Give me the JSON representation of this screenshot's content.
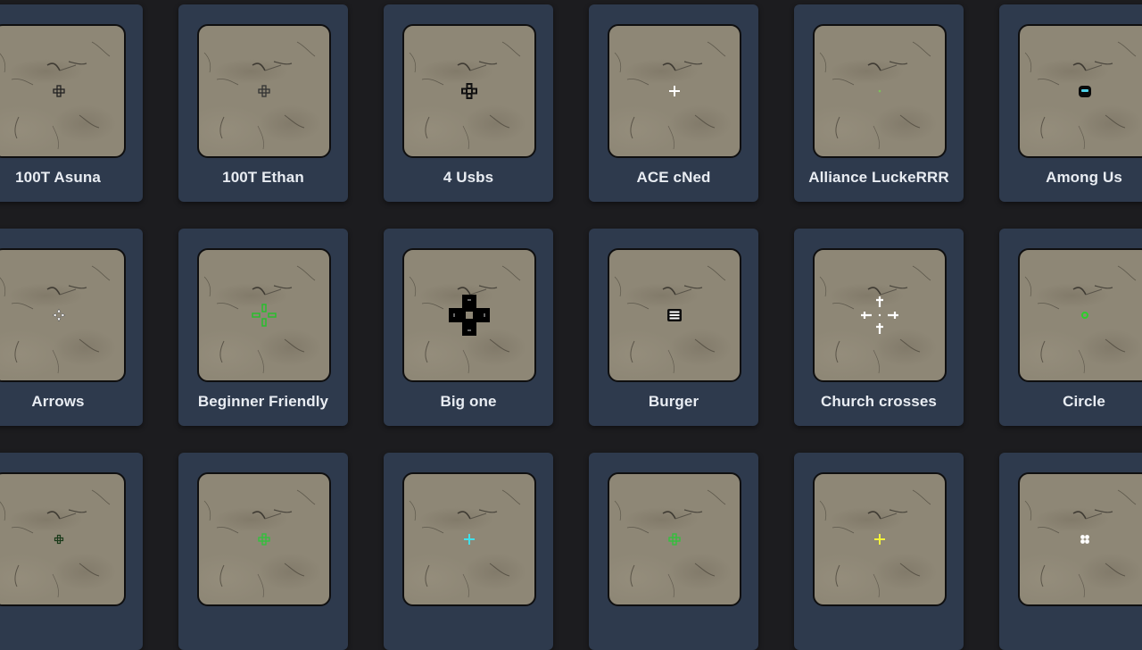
{
  "crosshairs": [
    {
      "name": "100T Asuna",
      "icon": "crosshair-outlined-plus-icon",
      "color": "#222222"
    },
    {
      "name": "100T Ethan",
      "icon": "crosshair-outlined-plus-icon",
      "color": "#333333"
    },
    {
      "name": "4 Usbs",
      "icon": "crosshair-four-blocks-icon",
      "color": "#111111"
    },
    {
      "name": "ACE cNed",
      "icon": "crosshair-plus-icon",
      "color": "#ffffff"
    },
    {
      "name": "Alliance LuckeRRR",
      "icon": "crosshair-dot-icon",
      "color": "#7dbf5a"
    },
    {
      "name": "Among Us",
      "icon": "crosshair-among-us-icon",
      "color": "#4fd2e8"
    },
    {
      "name": "Arrows",
      "icon": "crosshair-arrows-icon",
      "color": "#ffffff"
    },
    {
      "name": "Beginner Friendly",
      "icon": "crosshair-gap-plus-icon",
      "color": "#22c12a"
    },
    {
      "name": "Big one",
      "icon": "crosshair-big-plus-icon",
      "color": "#000000"
    },
    {
      "name": "Burger",
      "icon": "crosshair-burger-icon",
      "color": "#ffffff"
    },
    {
      "name": "Church crosses",
      "icon": "crosshair-church-crosses-icon",
      "color": "#ffffff"
    },
    {
      "name": "Circle",
      "icon": "crosshair-circle-icon",
      "color": "#2ad12a"
    },
    {
      "name": "",
      "icon": "crosshair-small-plus-icon",
      "color": "#1a3a1a"
    },
    {
      "name": "",
      "icon": "crosshair-outlined-plus-icon",
      "color": "#2ec43a"
    },
    {
      "name": "",
      "icon": "crosshair-plus-icon",
      "color": "#3fe0ea"
    },
    {
      "name": "",
      "icon": "crosshair-outlined-plus-icon",
      "color": "#2ec43a"
    },
    {
      "name": "",
      "icon": "crosshair-plus-icon",
      "color": "#f2f23a"
    },
    {
      "name": "",
      "icon": "crosshair-quad-dots-icon",
      "color": "#ffffff"
    }
  ]
}
